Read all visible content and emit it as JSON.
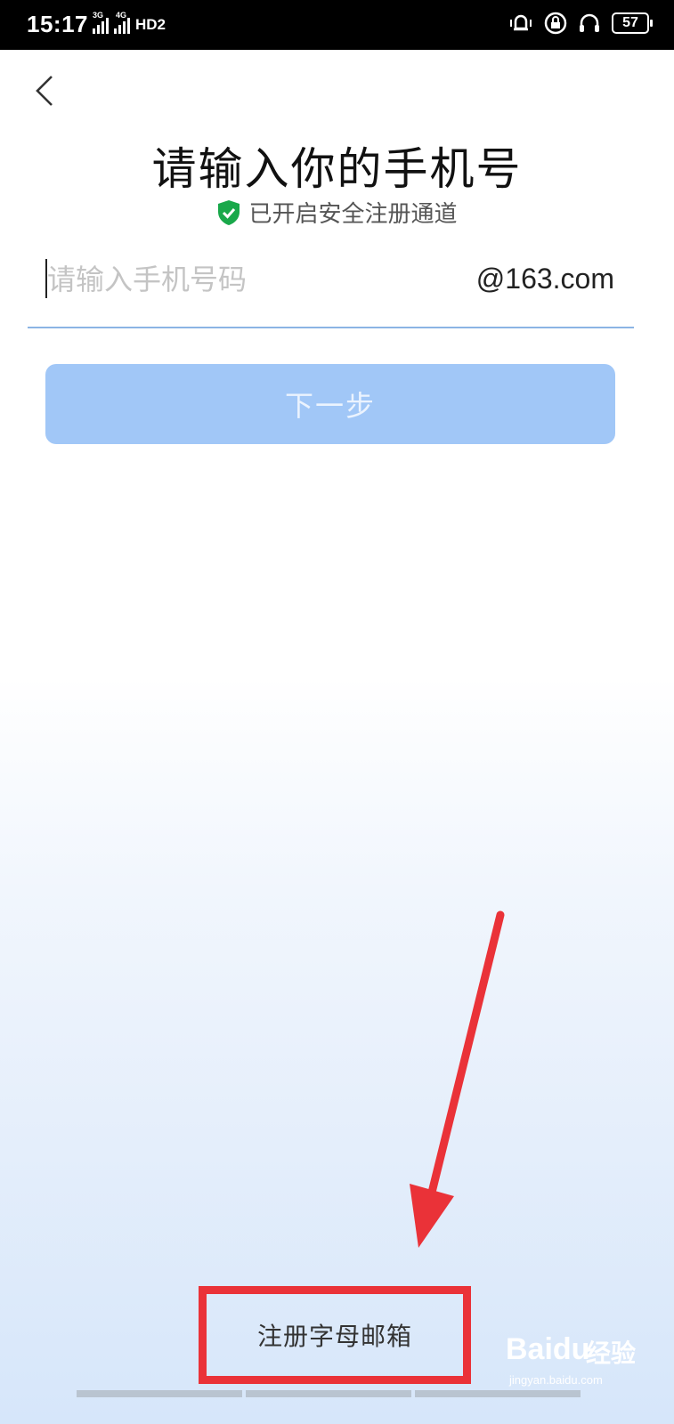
{
  "status_bar": {
    "time": "15:17",
    "signal1_label": "3G",
    "signal2_label": "4G",
    "hd_label": "HD2",
    "battery": "57"
  },
  "header": {
    "title": "请输入你的手机号",
    "secure_note": "已开启安全注册通道"
  },
  "form": {
    "phone_placeholder": "请输入手机号码",
    "phone_value": "",
    "domain_suffix": "@163.com",
    "next_label": "下一步"
  },
  "footer": {
    "register_letter_email": "注册字母邮箱"
  },
  "watermark": {
    "brand": "Baidu",
    "cn": "经验",
    "url": "jingyan.baidu.com"
  },
  "colors": {
    "accent_disabled": "#a1c7f7",
    "underline": "#8bb4e4",
    "secure_green": "#19a84a",
    "highlight_red": "#ea3238"
  },
  "icons": {
    "back": "chevron-left-icon",
    "secure": "shield-check-icon",
    "vibrate": "vibrate-bell-icon",
    "lock": "lock-rotation-icon",
    "headset": "headset-icon"
  }
}
